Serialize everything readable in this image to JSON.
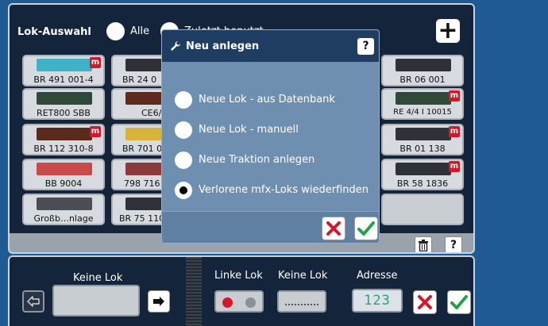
{
  "header": {
    "title": "Lok-Auswahl",
    "filter_all": "Alle",
    "filter_recent": "Zuletzt benutzt"
  },
  "tiles": [
    {
      "label": "BR 491 001-4",
      "mfx": true
    },
    {
      "label": "BR 24 0",
      "mfx": false
    },
    {
      "label": "BR 06 001",
      "mfx": false
    },
    {
      "label": "RET800 SBB",
      "mfx": false
    },
    {
      "label": "CE6/",
      "mfx": false
    },
    {
      "label": "RE 4/4 I 10015",
      "mfx": true
    },
    {
      "label": "BR 112 310-8",
      "mfx": true
    },
    {
      "label": "BR 701 0",
      "mfx": false
    },
    {
      "label": "BR 01 138",
      "mfx": true
    },
    {
      "label": "BB 9004",
      "mfx": false
    },
    {
      "label": "798 716",
      "mfx": false
    },
    {
      "label": "BR 58 1836",
      "mfx": true
    },
    {
      "label": "Großb…nlage",
      "mfx": false
    },
    {
      "label": "BR 75 110",
      "mfx": false
    }
  ],
  "mfx_badge": "m",
  "dialog": {
    "title": "Neu anlegen",
    "help": "?",
    "options": [
      "Neue Lok - aus Datenbank",
      "Neue Lok - manuell",
      "Neue Traktion anlegen",
      "Verlorene mfx-Loks wiederfinden"
    ],
    "selected_index": 3
  },
  "top_help": "?",
  "bottom": {
    "current_loco": "Keine Lok",
    "linke_lok": "Linke Lok",
    "keine_lok": "Keine Lok",
    "address_label": "Adresse",
    "address_value": "123"
  },
  "colors": {
    "red": "#d6172a",
    "green": "#22a04a",
    "dialog_head": "#1f3d63",
    "panel_dark": "#14243a"
  }
}
